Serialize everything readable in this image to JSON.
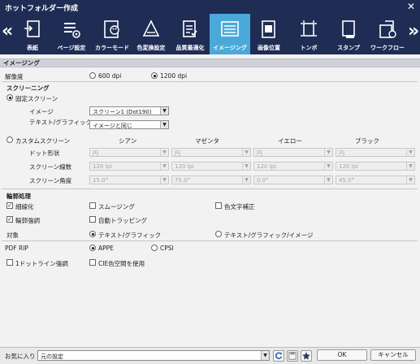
{
  "window": {
    "title": "ホットフォルダー作成",
    "close_icon": "close-icon"
  },
  "toolbar": {
    "prev_arrow": "«",
    "next_arrow": "»",
    "items": [
      {
        "label": "表紙",
        "icon": "cover-icon"
      },
      {
        "label": "ページ設定",
        "icon": "page-settings-icon"
      },
      {
        "label": "カラーモード",
        "icon": "color-mode-icon"
      },
      {
        "label": "色変換設定",
        "icon": "color-conversion-icon"
      },
      {
        "label": "品質最適化",
        "icon": "quality-icon"
      },
      {
        "label": "イメージング",
        "icon": "imaging-icon",
        "active": true
      },
      {
        "label": "画像位置",
        "icon": "image-position-icon"
      },
      {
        "label": "トンボ",
        "icon": "crop-marks-icon"
      },
      {
        "label": "スタンプ",
        "icon": "stamp-icon"
      },
      {
        "label": "ワークフロー",
        "icon": "workflow-icon"
      }
    ]
  },
  "imaging": {
    "section_title": "イメージング",
    "resolution_label": "解像度",
    "resolution_options": [
      "600 dpi",
      "1200 dpi"
    ],
    "resolution_selected": "1200 dpi"
  },
  "screening": {
    "section_title": "スクリーニング",
    "fixed_label": "固定スクリーン",
    "image_label": "イメージ",
    "image_value": "スクリーン1 (Dot190)",
    "textgraphic_label": "テキスト/グラフィック",
    "textgraphic_value": "イメージと同じ",
    "custom_label": "カスタムスクリーン",
    "columns": [
      "シアン",
      "マゼンタ",
      "イエロー",
      "ブラック"
    ],
    "rows": [
      {
        "label": "ドット形状",
        "values": [
          "円",
          "円",
          "円",
          "円"
        ]
      },
      {
        "label": "スクリーン線数",
        "values": [
          "120 lpi",
          "120 lpi",
          "120 lpi",
          "120 lpi"
        ]
      },
      {
        "label": "スクリーン角度",
        "values": [
          "15.0°",
          "75.0°",
          "0.0°",
          "45.0°"
        ]
      }
    ]
  },
  "outline": {
    "section_title": "輪郭処理",
    "thinning_label": "細線化",
    "thinning_checked": true,
    "smoothing_label": "スムージング",
    "smoothing_checked": false,
    "color_text_label": "色文字補正",
    "color_text_checked": false,
    "edge_enhance_label": "輪郭強調",
    "edge_enhance_checked": true,
    "auto_trapping_label": "自動トラッピング",
    "auto_trapping_checked": false,
    "target_label": "対象",
    "target_options": [
      "テキスト/グラフィック",
      "テキスト/グラフィック/イメージ"
    ],
    "target_selected": "テキスト/グラフィック"
  },
  "pdf": {
    "rip_label": "PDF RIP",
    "rip_options": [
      "APPE",
      "CPSI"
    ],
    "rip_selected": "APPE",
    "one_dot_label": "1ドットライン強調",
    "one_dot_checked": false,
    "cie_label": "CIE色空間を使用",
    "cie_checked": false
  },
  "footer": {
    "favorites_label": "お気に入り",
    "favorites_value": "元の設定",
    "ok_label": "OK",
    "cancel_label": "キャンセル"
  }
}
